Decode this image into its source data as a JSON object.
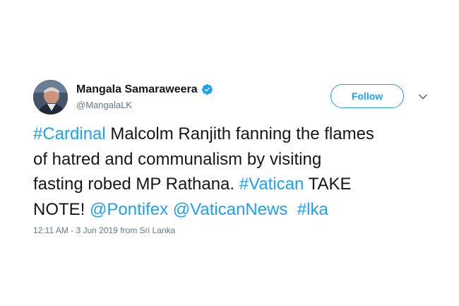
{
  "author": {
    "display_name": "Mangala Samaraweera",
    "handle": "@MangalaLK",
    "verified": true
  },
  "actions": {
    "follow_label": "Follow"
  },
  "tweet": {
    "lines": [
      [
        {
          "text": "#Cardinal",
          "type": "hashtag"
        },
        {
          "text": " Malcolm Ranjith fanning the flames",
          "type": "text"
        }
      ],
      [
        {
          "text": "of hatred and communalism by visiting",
          "type": "text"
        }
      ],
      [
        {
          "text": "fasting robed MP Rathana. ",
          "type": "text"
        },
        {
          "text": "#Vatican",
          "type": "hashtag"
        },
        {
          "text": " TAKE",
          "type": "text"
        }
      ],
      [
        {
          "text": "NOTE! ",
          "type": "text"
        },
        {
          "text": "@Pontifex",
          "type": "mention"
        },
        {
          "text": " ",
          "type": "text"
        },
        {
          "text": "@VaticanNews",
          "type": "mention"
        },
        {
          "text": "  ",
          "type": "text"
        },
        {
          "text": "#lka",
          "type": "hashtag"
        }
      ]
    ]
  },
  "meta": {
    "timestamp": "12:11 AM - 3 Jun 2019 from Sri Lanka"
  },
  "colors": {
    "link": "#1da1f2",
    "text": "#14171a",
    "secondary": "#657786"
  },
  "icons": {
    "verified": "verified-badge-icon",
    "menu": "chevron-down-icon"
  }
}
